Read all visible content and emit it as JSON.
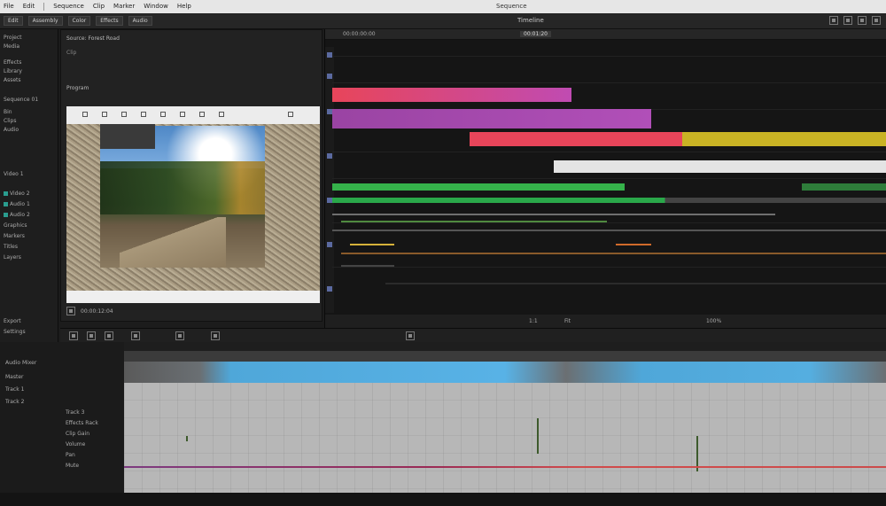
{
  "menu": {
    "items": [
      "File",
      "Edit",
      "Sequence",
      "Clip",
      "Marker",
      "Window",
      "Help"
    ],
    "title": "Sequence"
  },
  "toolbar": {
    "left_buttons": [
      "Edit",
      "Assembly",
      "Color",
      "Effects",
      "Audio"
    ],
    "center_label": "Timeline"
  },
  "left_panel": {
    "items": [
      "Project",
      "Media",
      "Effects",
      "Library",
      "Assets",
      "Sequence 01",
      "Bin",
      "Clips",
      "Audio",
      "Video 1",
      "Video 2",
      "Audio 1",
      "Audio 2",
      "Graphics",
      "Markers",
      "Titles",
      "Layers",
      "Export",
      "Settings"
    ]
  },
  "viewer": {
    "header": "Source: Forest Road",
    "sub": "Clip",
    "title": "Program",
    "timecode": "00:00:12:04"
  },
  "timeline": {
    "timecode": "00:00:00:00",
    "current": "00:01:20",
    "footer_left": "1:1",
    "footer_mid": "Fit",
    "footer_right": "100%"
  },
  "lower": {
    "items": [
      "Audio Mixer",
      "Master",
      "Track 1",
      "Track 2",
      "Track 3",
      "Effects Rack",
      "Clip Gain",
      "Volume",
      "Pan",
      "Mute"
    ]
  },
  "colors": {
    "red": "#e8455a",
    "magenta": "#b14fb8",
    "yellow": "#c9b324",
    "green": "#35b24a",
    "blue": "#4fa7d9"
  }
}
